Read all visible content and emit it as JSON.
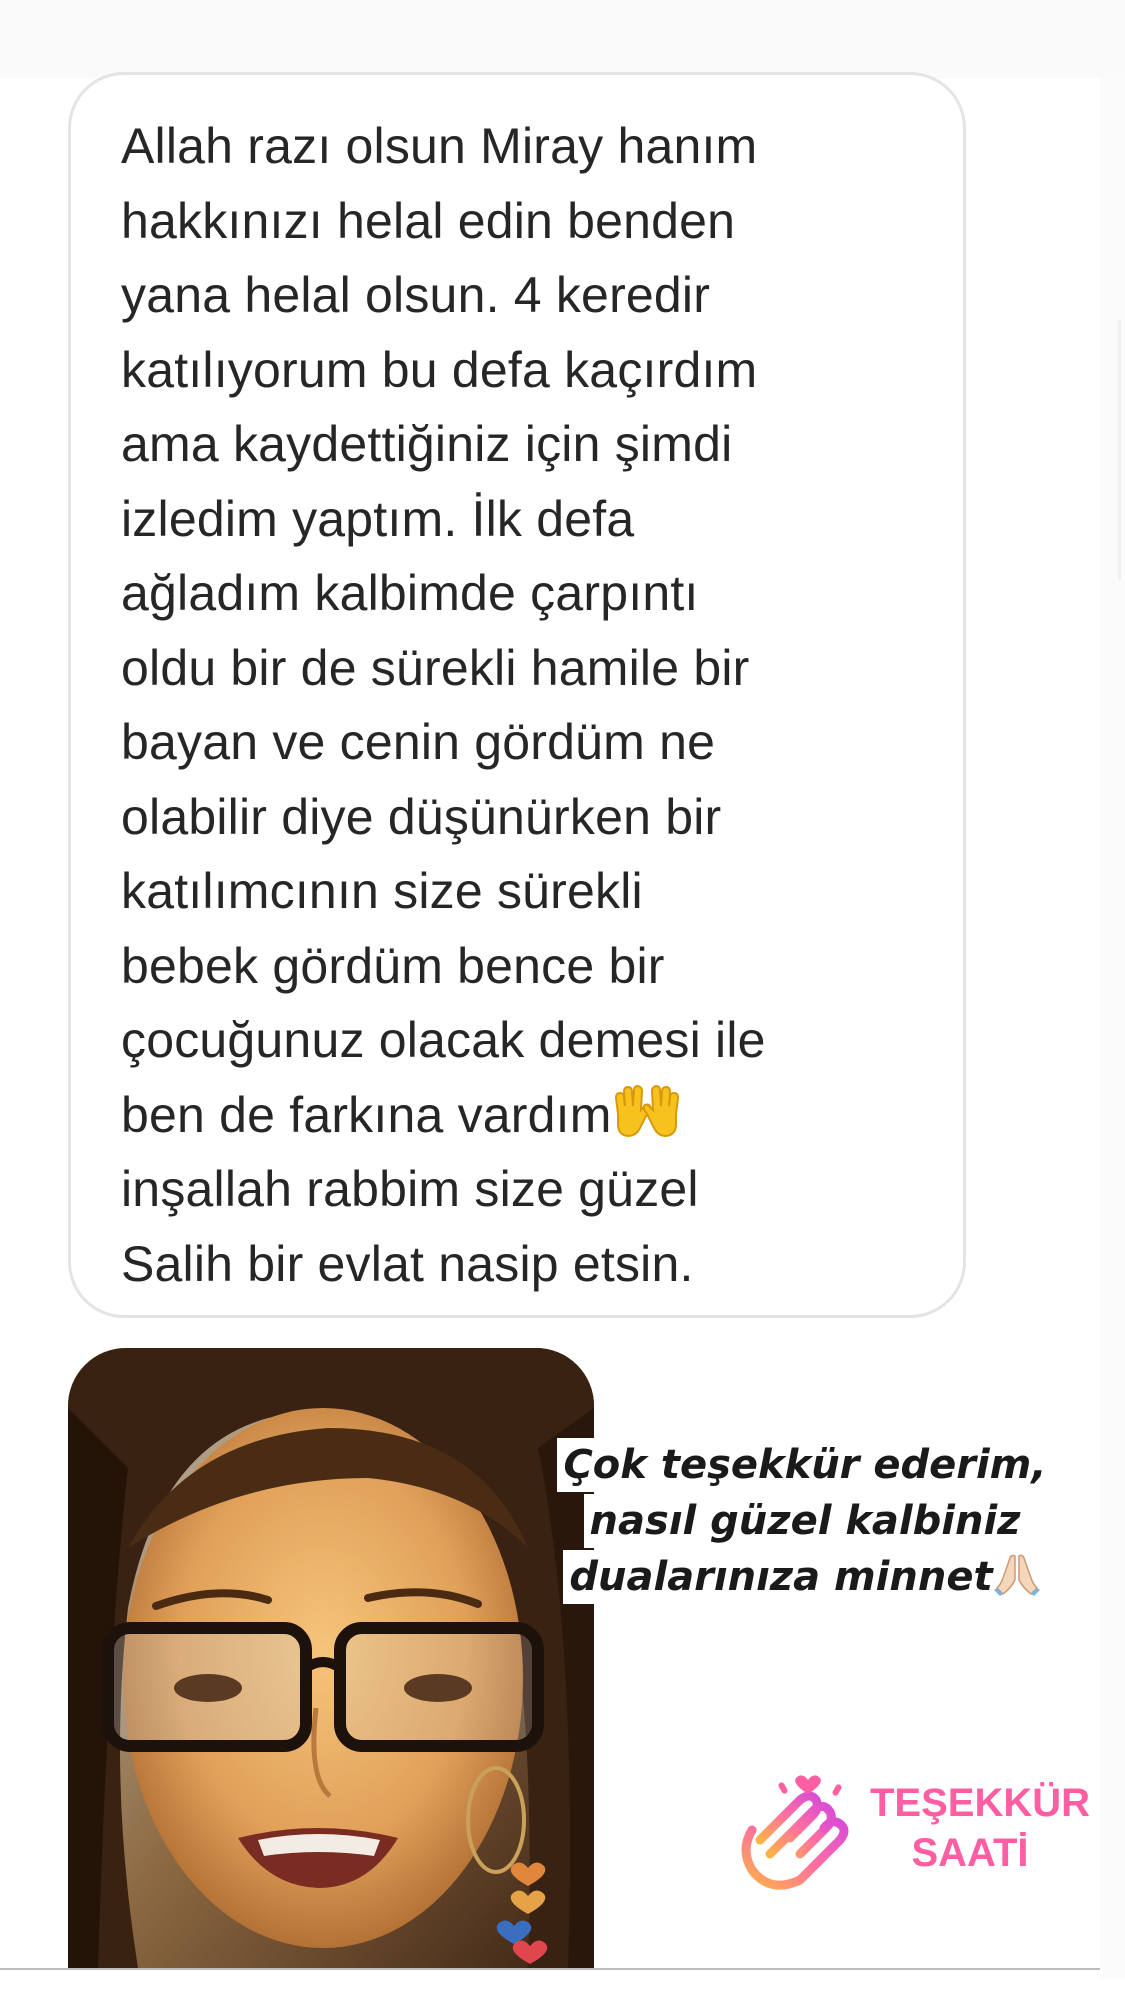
{
  "message": {
    "lines": [
      "Allah razı olsun Miray hanım",
      "hakkınızı helal edin benden",
      "yana helal olsun. 4 keredir",
      "katılıyorum bu defa kaçırdım",
      "ama kaydettiğiniz için şimdi",
      "izledim yaptım. İlk defa",
      "ağladım kalbimde çarpıntı",
      "oldu bir de sürekli hamile bir",
      "bayan ve cenin gördüm ne",
      "olabilir diye düşünürken bir",
      "katılımcının size sürekli",
      "bebek gördüm bence bir",
      "çocuğunuz olacak demesi ile",
      "ben de farkına vardım",
      "inşallah rabbim size güzel",
      "Salih bir evlat nasip etsin."
    ],
    "emoji_icon": "open-hands-emoji"
  },
  "caption": {
    "line1": "Çok teşekkür ederim,",
    "line2": "nasıl güzel kalbiniz",
    "line3": "dualarınıza minnet",
    "emoji_icon": "folded-hands-emoji"
  },
  "sticker": {
    "line1": "TEŞEKKÜR",
    "line2": "SAATİ",
    "icon": "clapping-hands-icon",
    "color": "#ff5fa2"
  },
  "video": {
    "icon": "live-video-frame"
  }
}
